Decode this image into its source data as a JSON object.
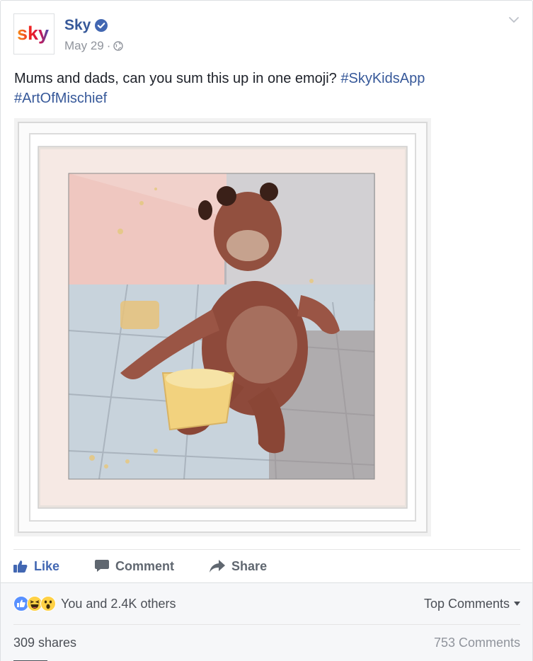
{
  "post": {
    "page_name": "Sky",
    "verified": true,
    "date": "May 29",
    "separator": "·",
    "text": "Mums and dads, can you sum this up in one emoji?",
    "hashtags": [
      "#SkyKidsApp",
      "#ArtOfMischief"
    ],
    "logo_text": "sky"
  },
  "icons": {
    "avatar": "sky-logo",
    "verified": "verified-badge-icon",
    "audience": "globe-icon",
    "options": "chevron-down-icon",
    "like": "thumbs-up-icon",
    "comment": "comment-bubble-icon",
    "share": "share-arrow-icon"
  },
  "actions": {
    "like_label": "Like",
    "comment_label": "Comment",
    "share_label": "Share"
  },
  "reactions": {
    "types": [
      "like",
      "haha",
      "wow"
    ],
    "summary": "You and 2.4K others",
    "sort_label": "Top Comments"
  },
  "stats": {
    "shares": "309 shares",
    "comments": "753 Comments"
  },
  "colors": {
    "link_blue": "#365899",
    "like_blue": "#4267b2",
    "muted_gray": "#90949c"
  }
}
